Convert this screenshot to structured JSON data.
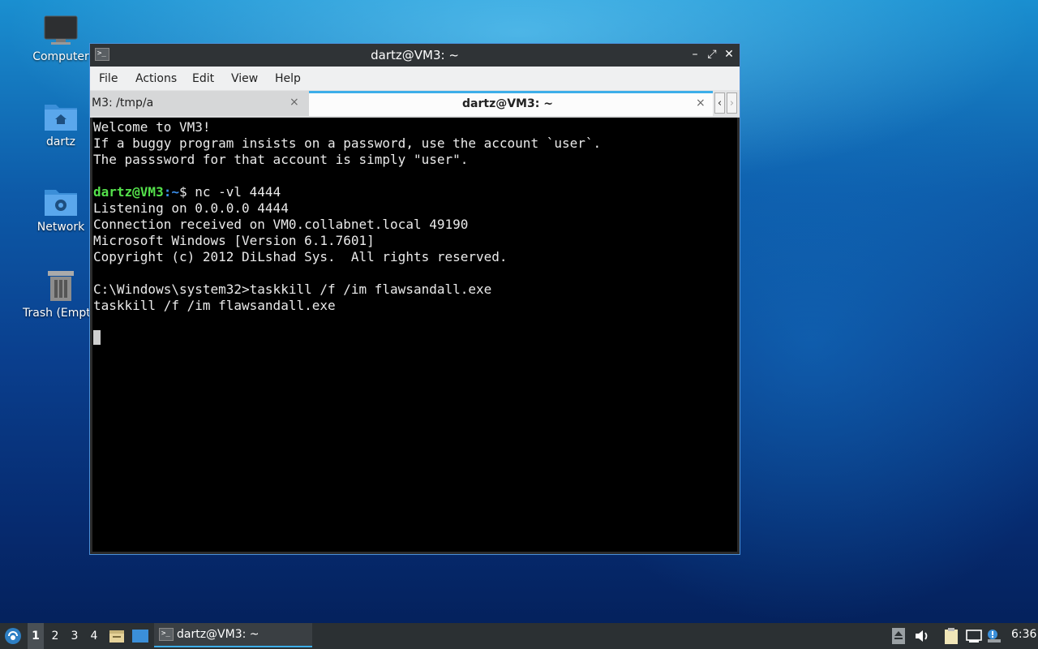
{
  "desktop": {
    "icons": [
      {
        "label": "Computer",
        "icon": "computer-icon"
      },
      {
        "label": "dartz",
        "icon": "home-folder-icon"
      },
      {
        "label": "Network",
        "icon": "network-folder-icon"
      },
      {
        "label": "Trash (Empty)",
        "icon": "trash-icon"
      }
    ]
  },
  "window": {
    "title": "dartz@VM3: ~",
    "menu": [
      "File",
      "Actions",
      "Edit",
      "View",
      "Help"
    ],
    "tabs": [
      {
        "label": "M3: /tmp/a",
        "close": "×"
      },
      {
        "label": "dartz@VM3: ~",
        "close": "×"
      }
    ],
    "controls": {
      "minimize": "–",
      "maximize": "⤢",
      "close": "✕"
    }
  },
  "terminal": {
    "welcome": [
      "Welcome to VM3!",
      "If a buggy program insists on a password, use the account `user`.",
      "The passsword for that account is simply \"user\"."
    ],
    "prompt_user": "dartz@VM3",
    "prompt_path": ":~",
    "prompt_symbol": "$ ",
    "command": "nc -vl 4444",
    "output": [
      "Listening on 0.0.0.0 4444",
      "Connection received on VM0.collabnet.local 49190",
      "Microsoft Windows [Version 6.1.7601]",
      "Copyright (c) 2012 DiLshad Sys.  All rights reserved."
    ],
    "remote_cmd": "C:\\Windows\\system32>taskkill /f /im flawsandall.exe",
    "remote_echo": "taskkill /f /im flawsandall.exe"
  },
  "taskbar": {
    "workspaces": [
      "1",
      "2",
      "3",
      "4"
    ],
    "task_label": "dartz@VM3: ~",
    "clock": "6:36"
  },
  "colors": {
    "accent": "#3daee9",
    "prompt_user": "#54e04b",
    "prompt_path": "#3b8eea"
  }
}
